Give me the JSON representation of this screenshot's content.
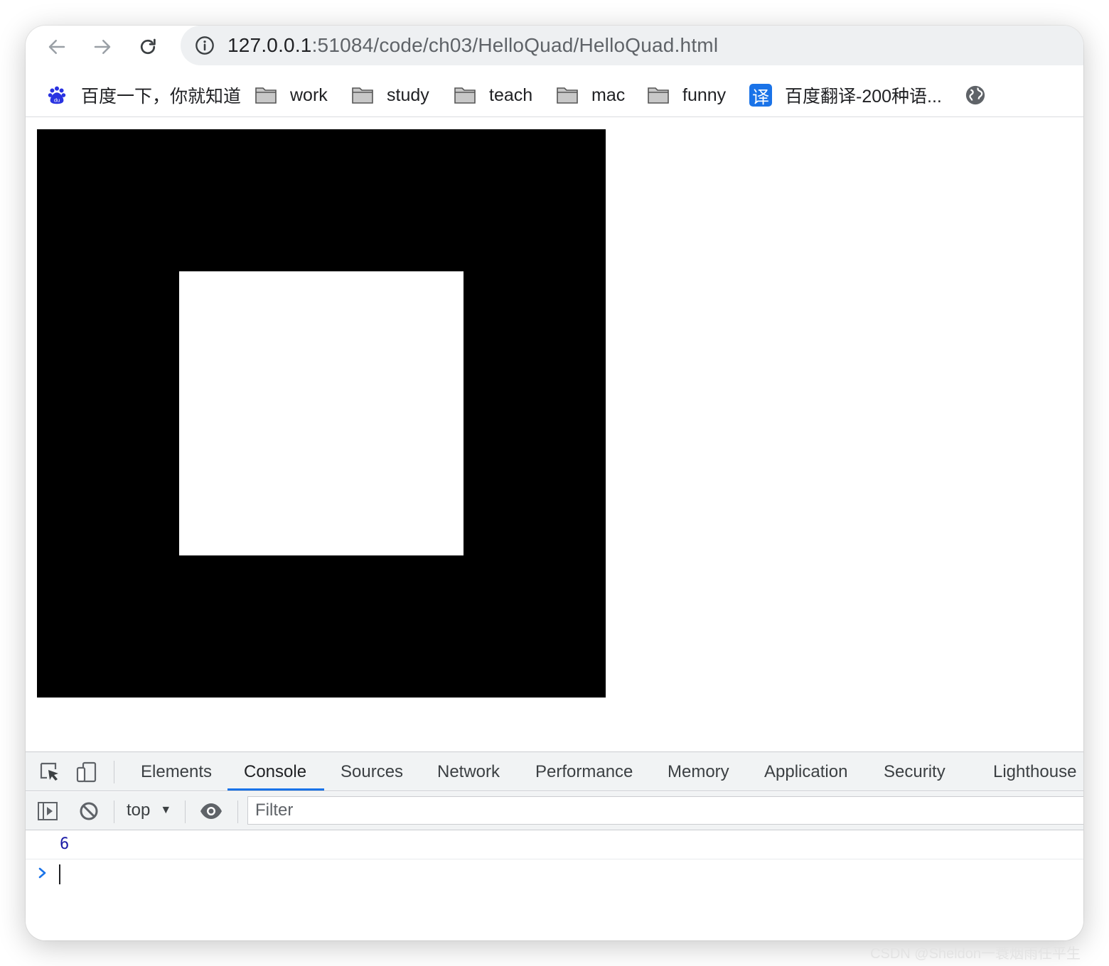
{
  "browser": {
    "url_host": "127.0.0.1",
    "url_path": ":51084/code/ch03/HelloQuad/HelloQuad.html"
  },
  "bookmarks": [
    {
      "label": "百度一下，你就知道",
      "icon": "baidu-paw-icon"
    },
    {
      "label": "work",
      "icon": "folder-icon"
    },
    {
      "label": "study",
      "icon": "folder-icon"
    },
    {
      "label": "teach",
      "icon": "folder-icon"
    },
    {
      "label": "mac",
      "icon": "folder-icon"
    },
    {
      "label": "funny",
      "icon": "folder-icon"
    },
    {
      "label": "百度翻译-200种语...",
      "icon": "translate-icon",
      "icon_text": "译"
    },
    {
      "label": "",
      "icon": "globe-icon"
    }
  ],
  "devtools": {
    "tabs": [
      "Elements",
      "Console",
      "Sources",
      "Network",
      "Performance",
      "Memory",
      "Application",
      "Security",
      "Lighthouse"
    ],
    "active_tab": "Console",
    "context": "top",
    "filter_placeholder": "Filter",
    "console_output": "6"
  },
  "colors": {
    "canvas_background": "#000000",
    "quad_fill": "#ffffff",
    "accent": "#1a73e8",
    "console_number": "#1a1aa6"
  },
  "watermark": "CSDN @Sheldon一蓑烟雨任平生"
}
